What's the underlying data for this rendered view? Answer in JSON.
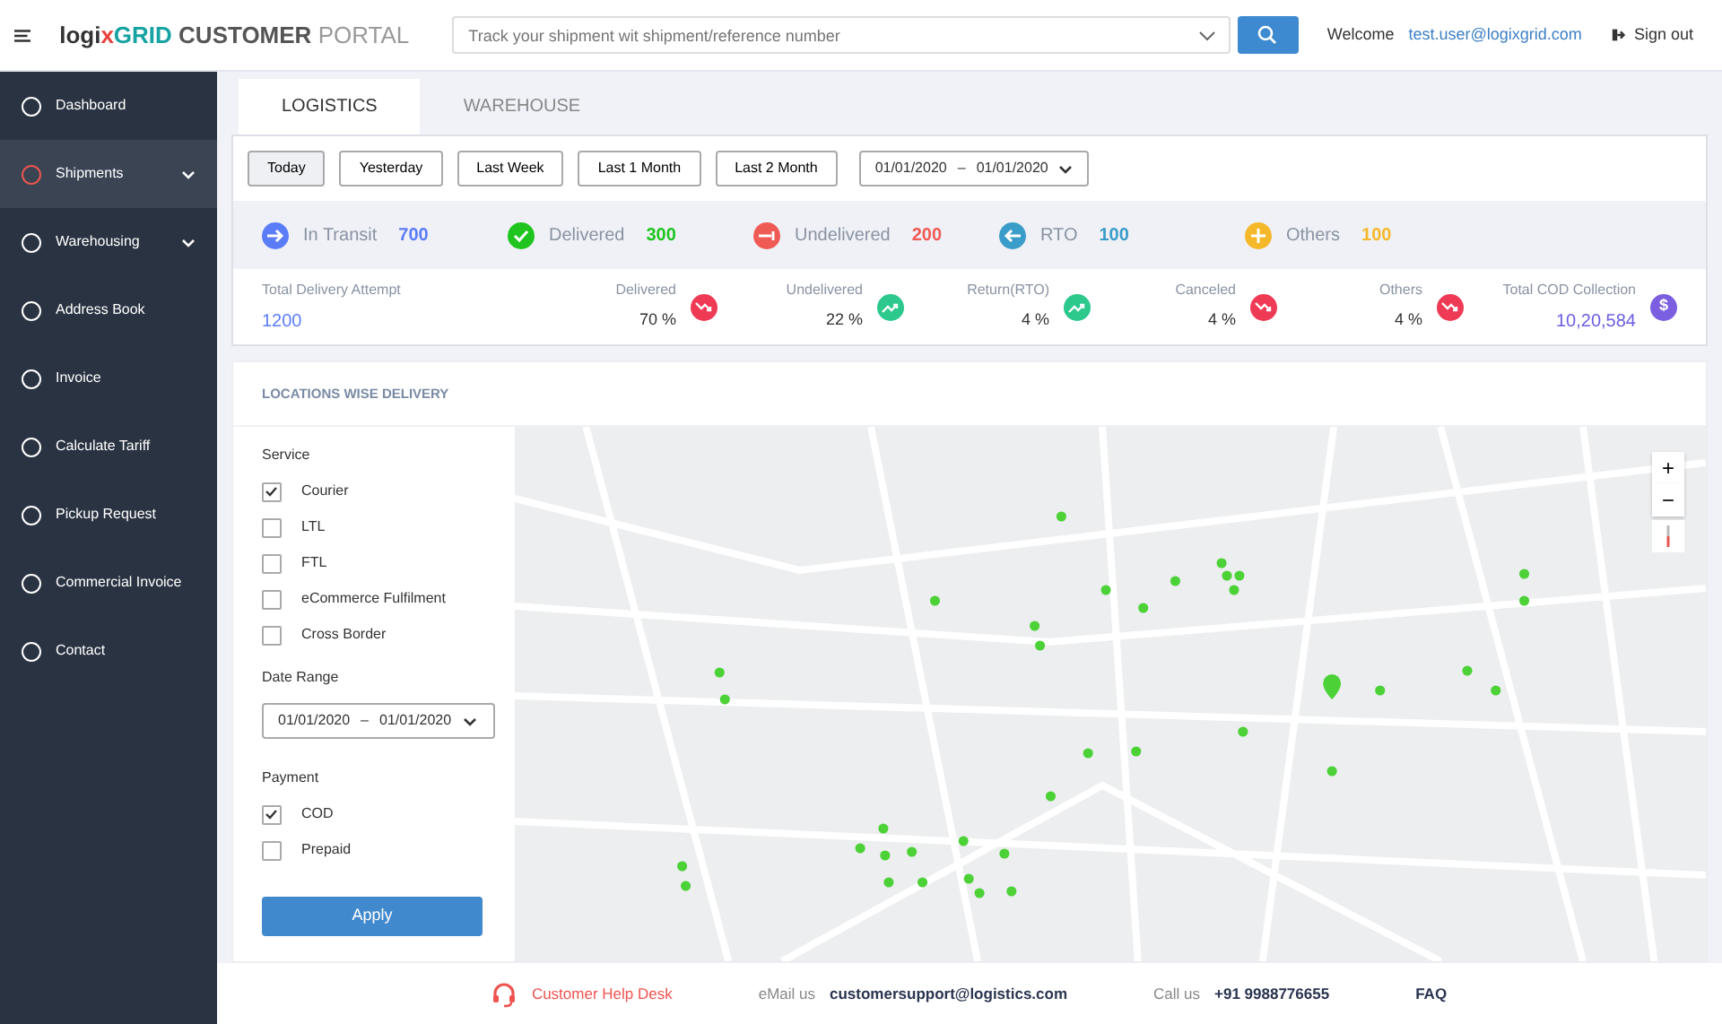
{
  "header": {
    "logo": {
      "brand_a": "logi",
      "brand_mark": "x",
      "brand_b": "GRID",
      "title_a": "CUSTOMER",
      "title_b": "PORTAL"
    },
    "search": {
      "placeholder": "Track your shipment wit shipment/reference number"
    },
    "welcome": "Welcome",
    "user": "test.user@logixgrid.com",
    "signout": "Sign out"
  },
  "sidebar": {
    "items": [
      {
        "label": "Dashboard",
        "selected": false,
        "expandable": false
      },
      {
        "label": "Shipments",
        "selected": true,
        "expandable": true
      },
      {
        "label": "Warehousing",
        "selected": false,
        "expandable": true
      },
      {
        "label": "Address Book",
        "selected": false,
        "expandable": false
      },
      {
        "label": "Invoice",
        "selected": false,
        "expandable": false
      },
      {
        "label": "Calculate Tariff",
        "selected": false,
        "expandable": false
      },
      {
        "label": "Pickup Request",
        "selected": false,
        "expandable": false
      },
      {
        "label": "Commercial Invoice",
        "selected": false,
        "expandable": false
      },
      {
        "label": "Contact",
        "selected": false,
        "expandable": false
      }
    ]
  },
  "tabs": [
    {
      "label": "LOGISTICS",
      "selected": true
    },
    {
      "label": "WAREHOUSE",
      "selected": false
    }
  ],
  "periods": [
    {
      "label": "Today",
      "selected": true
    },
    {
      "label": "Yesterday",
      "selected": false
    },
    {
      "label": "Last Week",
      "selected": false
    },
    {
      "label": "Last 1 Month",
      "selected": false
    },
    {
      "label": "Last 2 Month",
      "selected": false
    }
  ],
  "date_range": {
    "from": "01/01/2020",
    "sep": "–",
    "to": "01/01/2020"
  },
  "statuses": [
    {
      "kind": "right",
      "label": "In Transit",
      "value": "700",
      "color": "#5b7cf7"
    },
    {
      "kind": "check",
      "label": "Delivered",
      "value": "300",
      "color": "#1fc41f"
    },
    {
      "kind": "bar",
      "label": "Undelivered",
      "value": "200",
      "color": "#f05a55"
    },
    {
      "kind": "left",
      "label": "RTO",
      "value": "100",
      "color": "#3a9cc8"
    },
    {
      "kind": "plus",
      "label": "Others",
      "value": "100",
      "color": "#f5b82a"
    }
  ],
  "total_attempt": {
    "label": "Total Delivery Attempt",
    "value": "1200"
  },
  "metrics": [
    {
      "label": "Delivered",
      "value": "70 %",
      "kind": "down"
    },
    {
      "label": "Undelivered",
      "value": "22 %",
      "kind": "up"
    },
    {
      "label": "Return(RTO)",
      "value": "4 %",
      "kind": "up"
    },
    {
      "label": "Canceled",
      "value": "4 %",
      "kind": "down"
    },
    {
      "label": "Others",
      "value": "4 %",
      "kind": "down"
    }
  ],
  "cod": {
    "label": "Total COD Collection",
    "value": "10,20,584",
    "symbol": "$"
  },
  "locations": {
    "title": "LOCATIONS WISE DELIVERY",
    "service_label": "Service",
    "services": [
      {
        "label": "Courier",
        "checked": true
      },
      {
        "label": "LTL",
        "checked": false
      },
      {
        "label": "FTL",
        "checked": false
      },
      {
        "label": "eCommerce Fulfilment",
        "checked": false
      },
      {
        "label": "Cross Border",
        "checked": false
      }
    ],
    "date_label": "Date Range",
    "date_range": {
      "from": "01/01/2020",
      "sep": "–",
      "to": "01/01/2020"
    },
    "payment_label": "Payment",
    "payments": [
      {
        "label": "COD",
        "checked": true
      },
      {
        "label": "Prepaid",
        "checked": false
      }
    ],
    "apply": "Apply",
    "zoom_in": "+",
    "zoom_out": "−"
  },
  "footer": {
    "helpdesk": "Customer Help Desk",
    "email_label": "eMail us",
    "email": "customersupport@logistics.com",
    "call_label": "Call us",
    "phone": "+91 9988776655",
    "faq": "FAQ"
  }
}
